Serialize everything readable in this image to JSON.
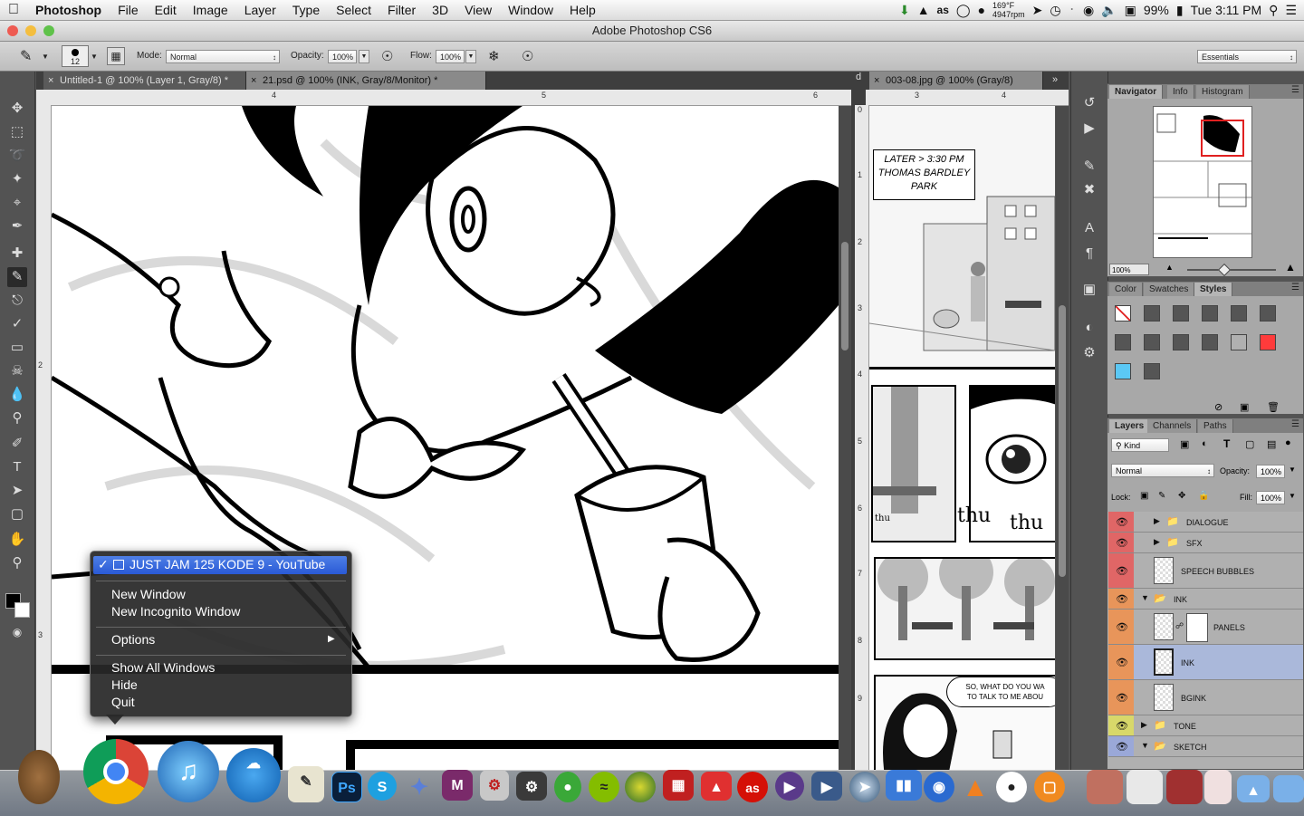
{
  "menubar": {
    "app_name": "Photoshop",
    "items": [
      "File",
      "Edit",
      "Image",
      "Layer",
      "Type",
      "Select",
      "Filter",
      "3D",
      "View",
      "Window",
      "Help"
    ],
    "temp": "169°F",
    "rpm": "4947rpm",
    "battery": "99%",
    "clock": "Tue 3:11 PM"
  },
  "window": {
    "title": "Adobe Photoshop CS6"
  },
  "options_bar": {
    "brush_size": "12",
    "mode_label": "Mode:",
    "mode_value": "Normal",
    "opacity_label": "Opacity:",
    "opacity_value": "100%",
    "flow_label": "Flow:",
    "flow_value": "100%",
    "workspace": "Essentials"
  },
  "doc_tabs": {
    "tab1": "Untitled-1 @ 100% (Layer 1, Gray/8) *",
    "tab2": "21.psd @ 100% (INK, Gray/8/Monitor) *",
    "tab3": "003-08.jpg @ 100% (Gray/8)",
    "collapse": "d"
  },
  "rulers": {
    "h1": [
      "4",
      "5",
      "6"
    ],
    "v1": [
      "2",
      "3"
    ],
    "h2": [
      "3",
      "4"
    ],
    "v2": [
      "0",
      "1",
      "2",
      "3",
      "4",
      "5",
      "6",
      "7",
      "8",
      "9"
    ]
  },
  "comic": {
    "caption": "LATER > 3:30 PM\nTHOMAS BARDLEY\nPARK",
    "sfx1": "thu",
    "sfx2": "thu",
    "sfx3": "thu",
    "dialogue": "SO, WHAT DO YOU WA\nTO TALK TO ME ABOU"
  },
  "navigator": {
    "tabs": [
      "Navigator",
      "Info",
      "Histogram"
    ],
    "zoom": "100%"
  },
  "color_panel": {
    "tabs": [
      "Color",
      "Swatches",
      "Styles"
    ],
    "accent_red": "#ff3b3b",
    "accent_blue": "#5bc8f5"
  },
  "layers_panel": {
    "tabs": [
      "Layers",
      "Channels",
      "Paths"
    ],
    "kind_label": "Kind",
    "blend_mode": "Normal",
    "opacity_label": "Opacity:",
    "opacity_value": "100%",
    "lock_label": "Lock:",
    "fill_label": "Fill:",
    "fill_value": "100%",
    "layers": [
      {
        "name": "DIALOGUE",
        "type": "group",
        "color": "#e06666"
      },
      {
        "name": "SFX",
        "type": "group",
        "color": "#e06666"
      },
      {
        "name": "SPEECH BUBBLES",
        "type": "layer",
        "color": "#e06666"
      },
      {
        "name": "INK",
        "type": "group",
        "color": "#e8955a"
      },
      {
        "name": "PANELS",
        "type": "layer",
        "color": "#e8955a"
      },
      {
        "name": "INK",
        "type": "layer",
        "color": "#e8955a",
        "selected": true
      },
      {
        "name": "BGINK",
        "type": "layer",
        "color": "#e8955a"
      },
      {
        "name": "TONE",
        "type": "group",
        "color": "#d8d86a"
      },
      {
        "name": "SKETCH",
        "type": "group",
        "color": "#9aa8d8"
      }
    ]
  },
  "context_menu": {
    "checked_item": "JUST JAM 125 KODE 9 - YouTube",
    "items": [
      "New Window",
      "New Incognito Window"
    ],
    "options": "Options",
    "bottom_items": [
      "Show All Windows",
      "Hide",
      "Quit"
    ]
  },
  "dock": {
    "icons": [
      "owl-app",
      "chrome",
      "itunes",
      "openoffice",
      "textedit",
      "photoshop",
      "skype",
      "growl",
      "mail-m",
      "automator",
      "steam",
      "frog",
      "spotify",
      "world",
      "flash",
      "sketchup",
      "lastfm",
      "video",
      "quicktime",
      "safari",
      "monitor",
      "vlc",
      "dog",
      "ibooks",
      "finder-folder"
    ],
    "ps_label": "Ps",
    "skype_label": "S",
    "m_label": "M"
  }
}
